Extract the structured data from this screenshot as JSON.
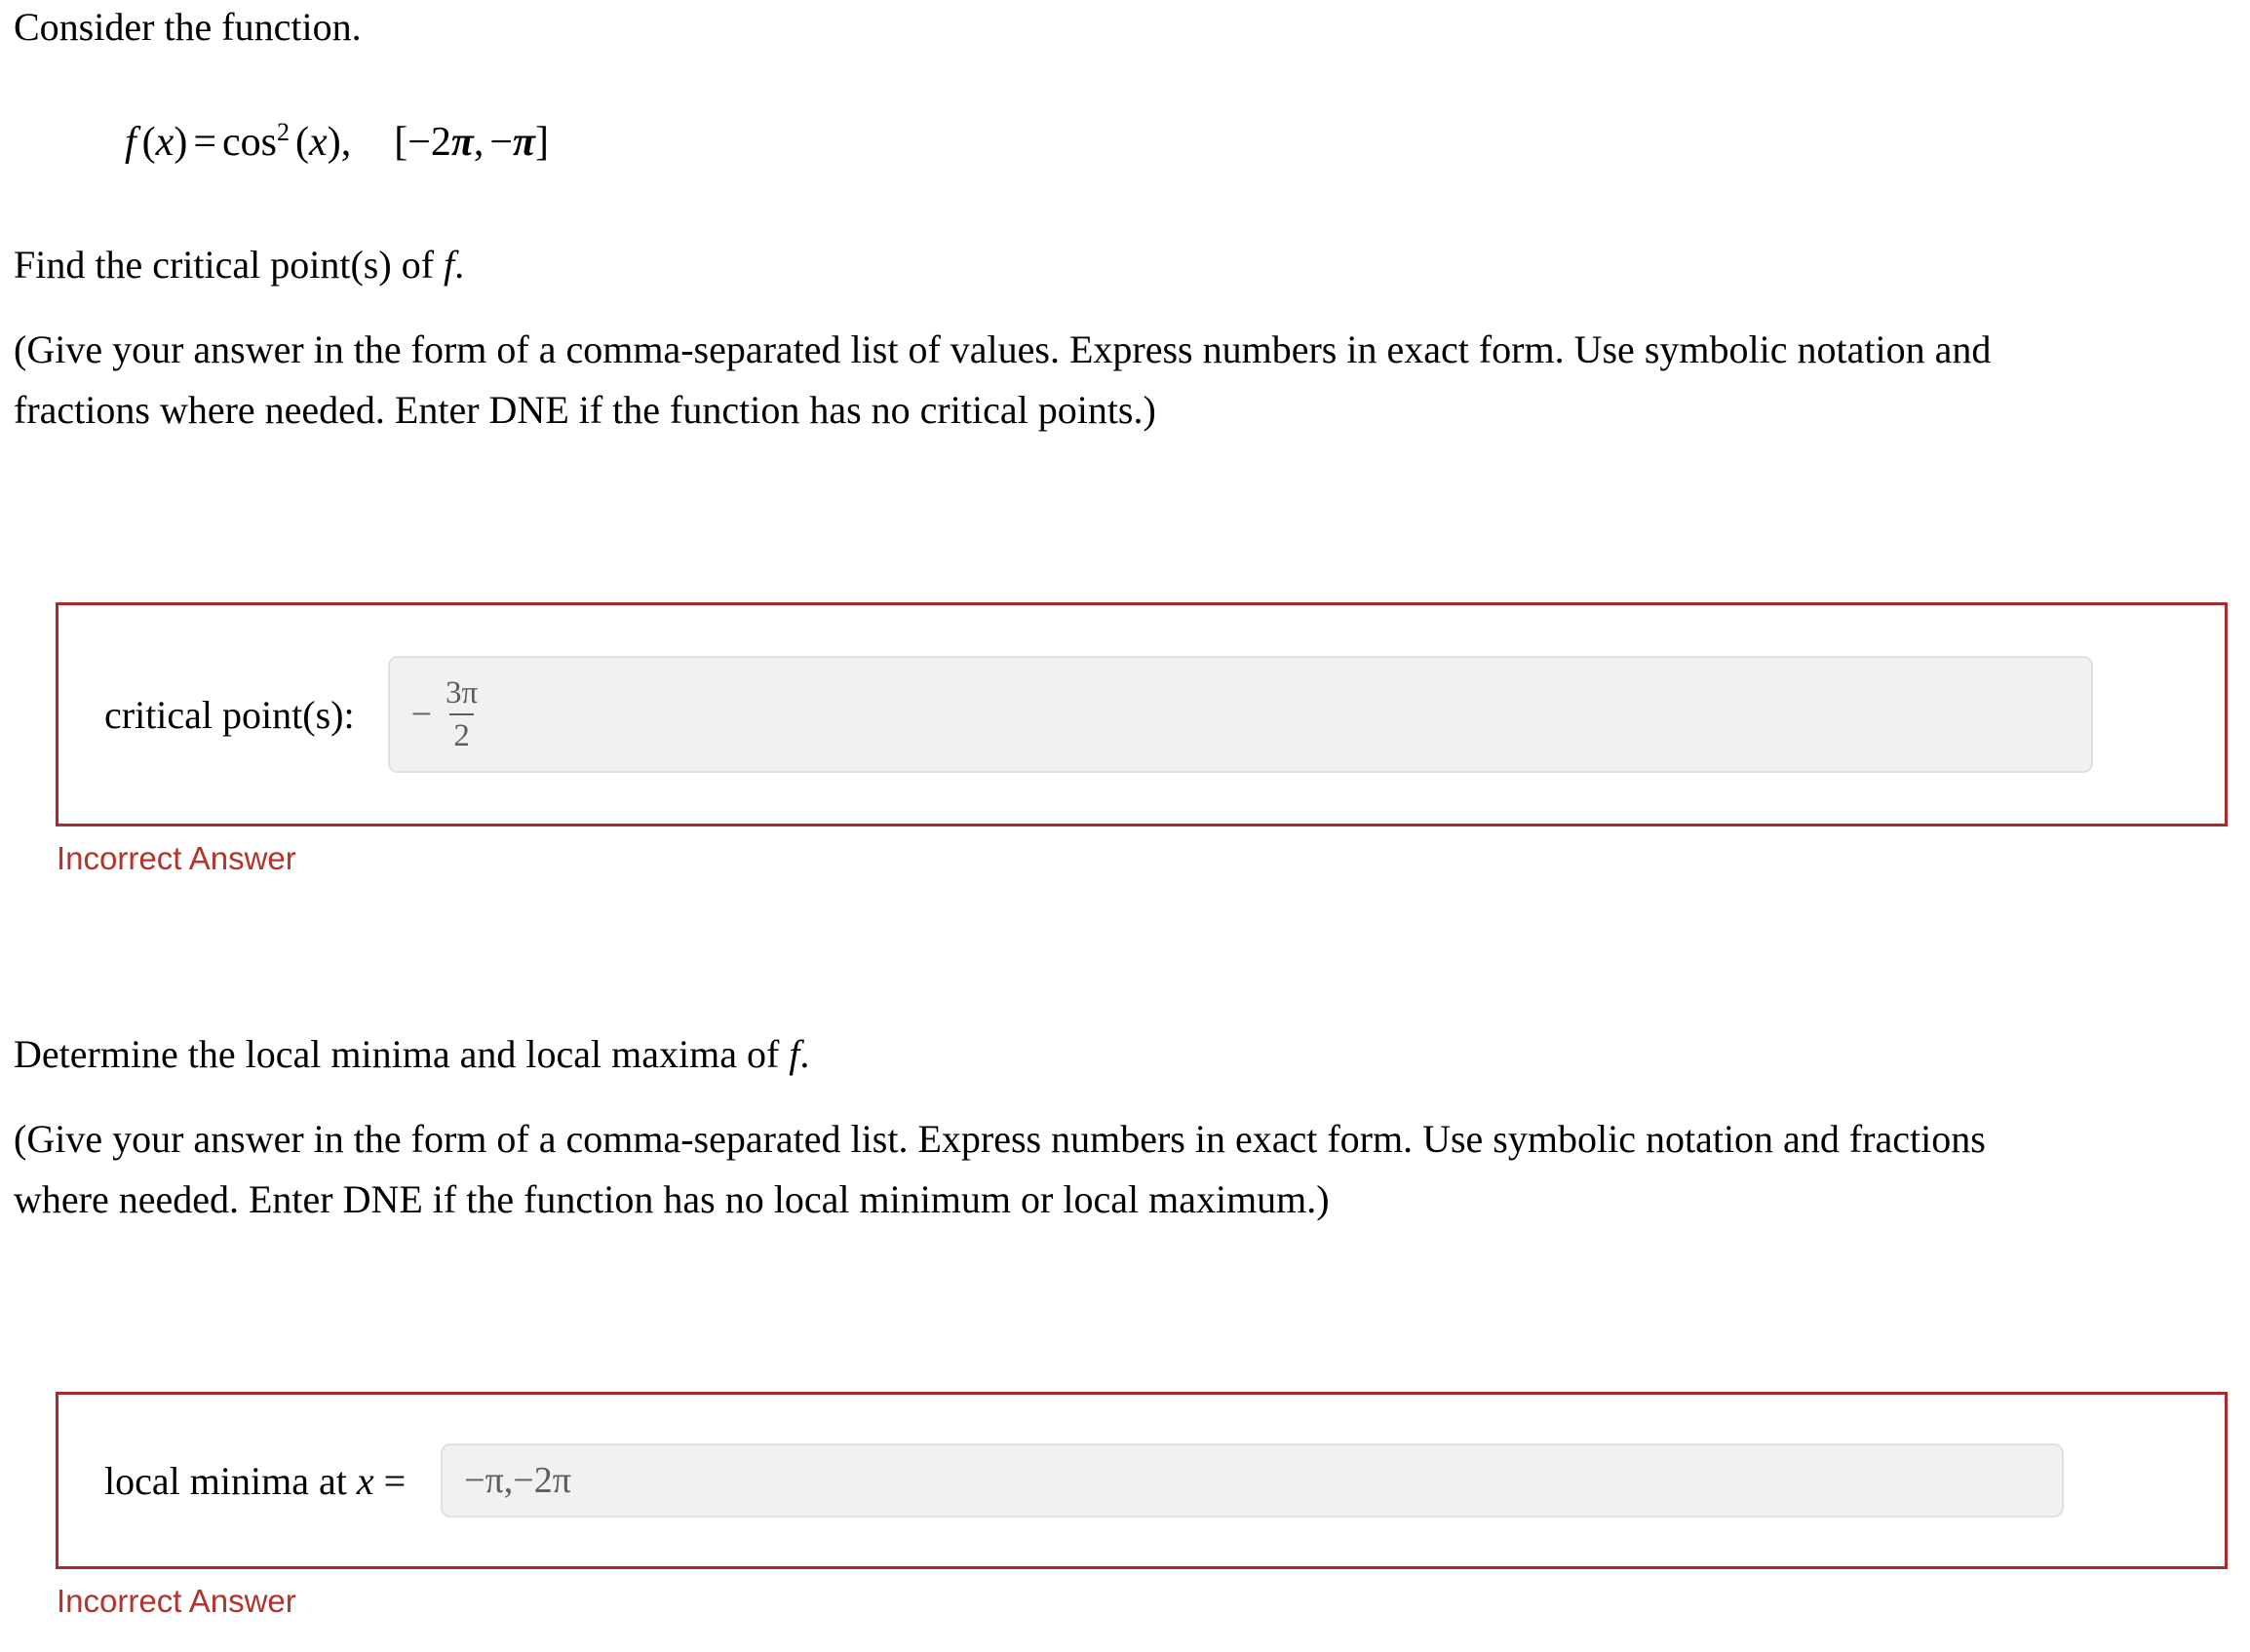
{
  "page": {
    "background": "#ffffff",
    "text_color": "#000000",
    "accent_red": "#a82c2c",
    "status_red": "#b3342d",
    "input_bg": "#f1f1f1",
    "input_border": "#e0e0e0",
    "input_text": "#5d5d5d"
  },
  "intro": {
    "heading": "Consider the function."
  },
  "formula": {
    "f_name": "f",
    "open_paren": "(",
    "var": "x",
    "close_paren": ")",
    "equals": "=",
    "cos": "cos",
    "exponent": "2",
    "arg_open": "(",
    "arg_var": "x",
    "arg_close": ")",
    "comma": ",",
    "interval_open": "[",
    "interval_lower_sign": "−",
    "interval_lower_coeff": "2",
    "interval_lower_pi": "π",
    "interval_comma": ",",
    "interval_upper_sign": "−",
    "interval_upper_pi": "π",
    "interval_close": "]",
    "plain": "f (x) = cos² (x),   [−2π, −π]"
  },
  "question1": {
    "prompt": "Find the critical point(s) of",
    "prompt_var": "f",
    "prompt_end": ".",
    "instructions_line1": "(Give your answer in the form of a comma-separated list of values. Express numbers in exact form. Use symbolic notation and",
    "instructions_line2": "fractions where needed. Enter DNE if the function has no critical points.)",
    "answer": {
      "label": "critical point(s):",
      "value_plain": "− 3π/2",
      "minus": "−",
      "numerator": "3π",
      "denominator": "2",
      "placeholder": ""
    },
    "status": "Incorrect Answer"
  },
  "question2": {
    "prompt": "Determine the local minima and local maxima of",
    "prompt_var": "f",
    "prompt_end": ".",
    "instructions_line1": "(Give your answer in the form of a comma-separated list. Express numbers in exact form. Use symbolic notation and fractions",
    "instructions_line2": "where needed. Enter DNE if the function has no local minimum or local maximum.)",
    "answer": {
      "label_text": "local minima at",
      "label_var": "x",
      "label_equals": "=",
      "value": "−π,−2π",
      "placeholder": ""
    },
    "status": "Incorrect Answer"
  }
}
